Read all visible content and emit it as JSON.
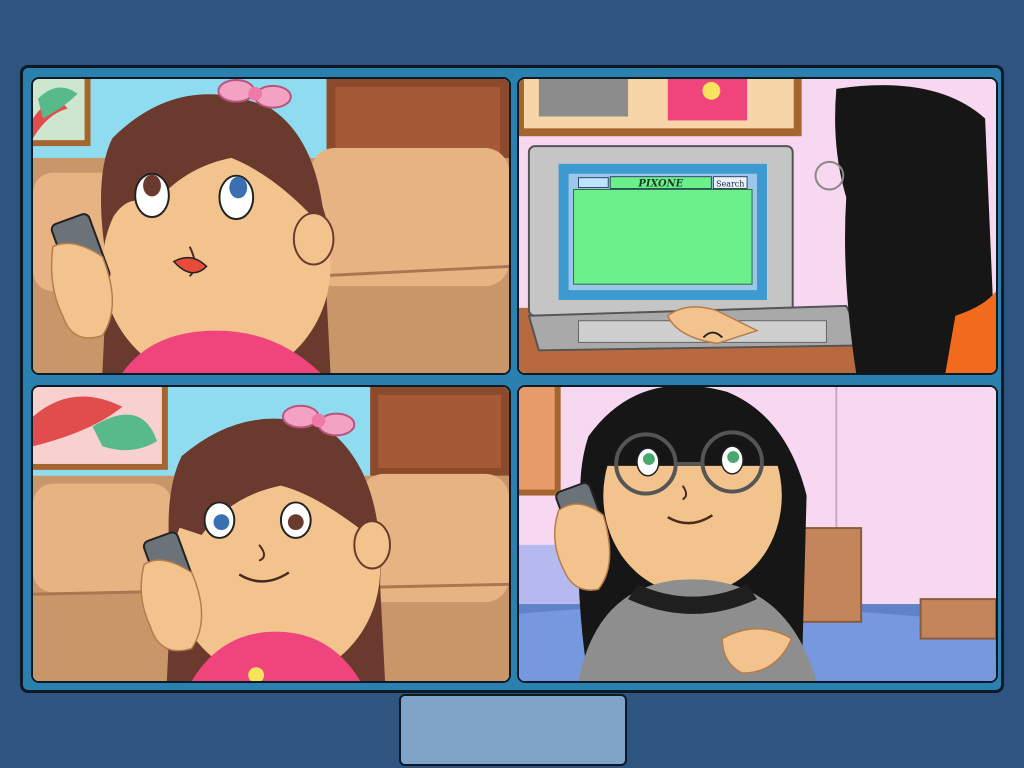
{
  "screen": {
    "colors": {
      "background": "#2e5480",
      "board": "#2a80ae",
      "button": "#80a4c8",
      "outline": "#0d1a26"
    }
  },
  "comic": {
    "panels": [
      {
        "id": 1,
        "scene": "girl-pink-bow-on-phone-looking-up"
      },
      {
        "id": 2,
        "scene": "girl-glasses-typing-on-laptop"
      },
      {
        "id": 3,
        "scene": "girl-pink-bow-on-phone-smiling"
      },
      {
        "id": 4,
        "scene": "girl-glasses-on-phone-smiling"
      }
    ],
    "laptop": {
      "site_name": "PIXONE",
      "search_label": "Search"
    }
  },
  "controls": {
    "continue_label": ""
  }
}
